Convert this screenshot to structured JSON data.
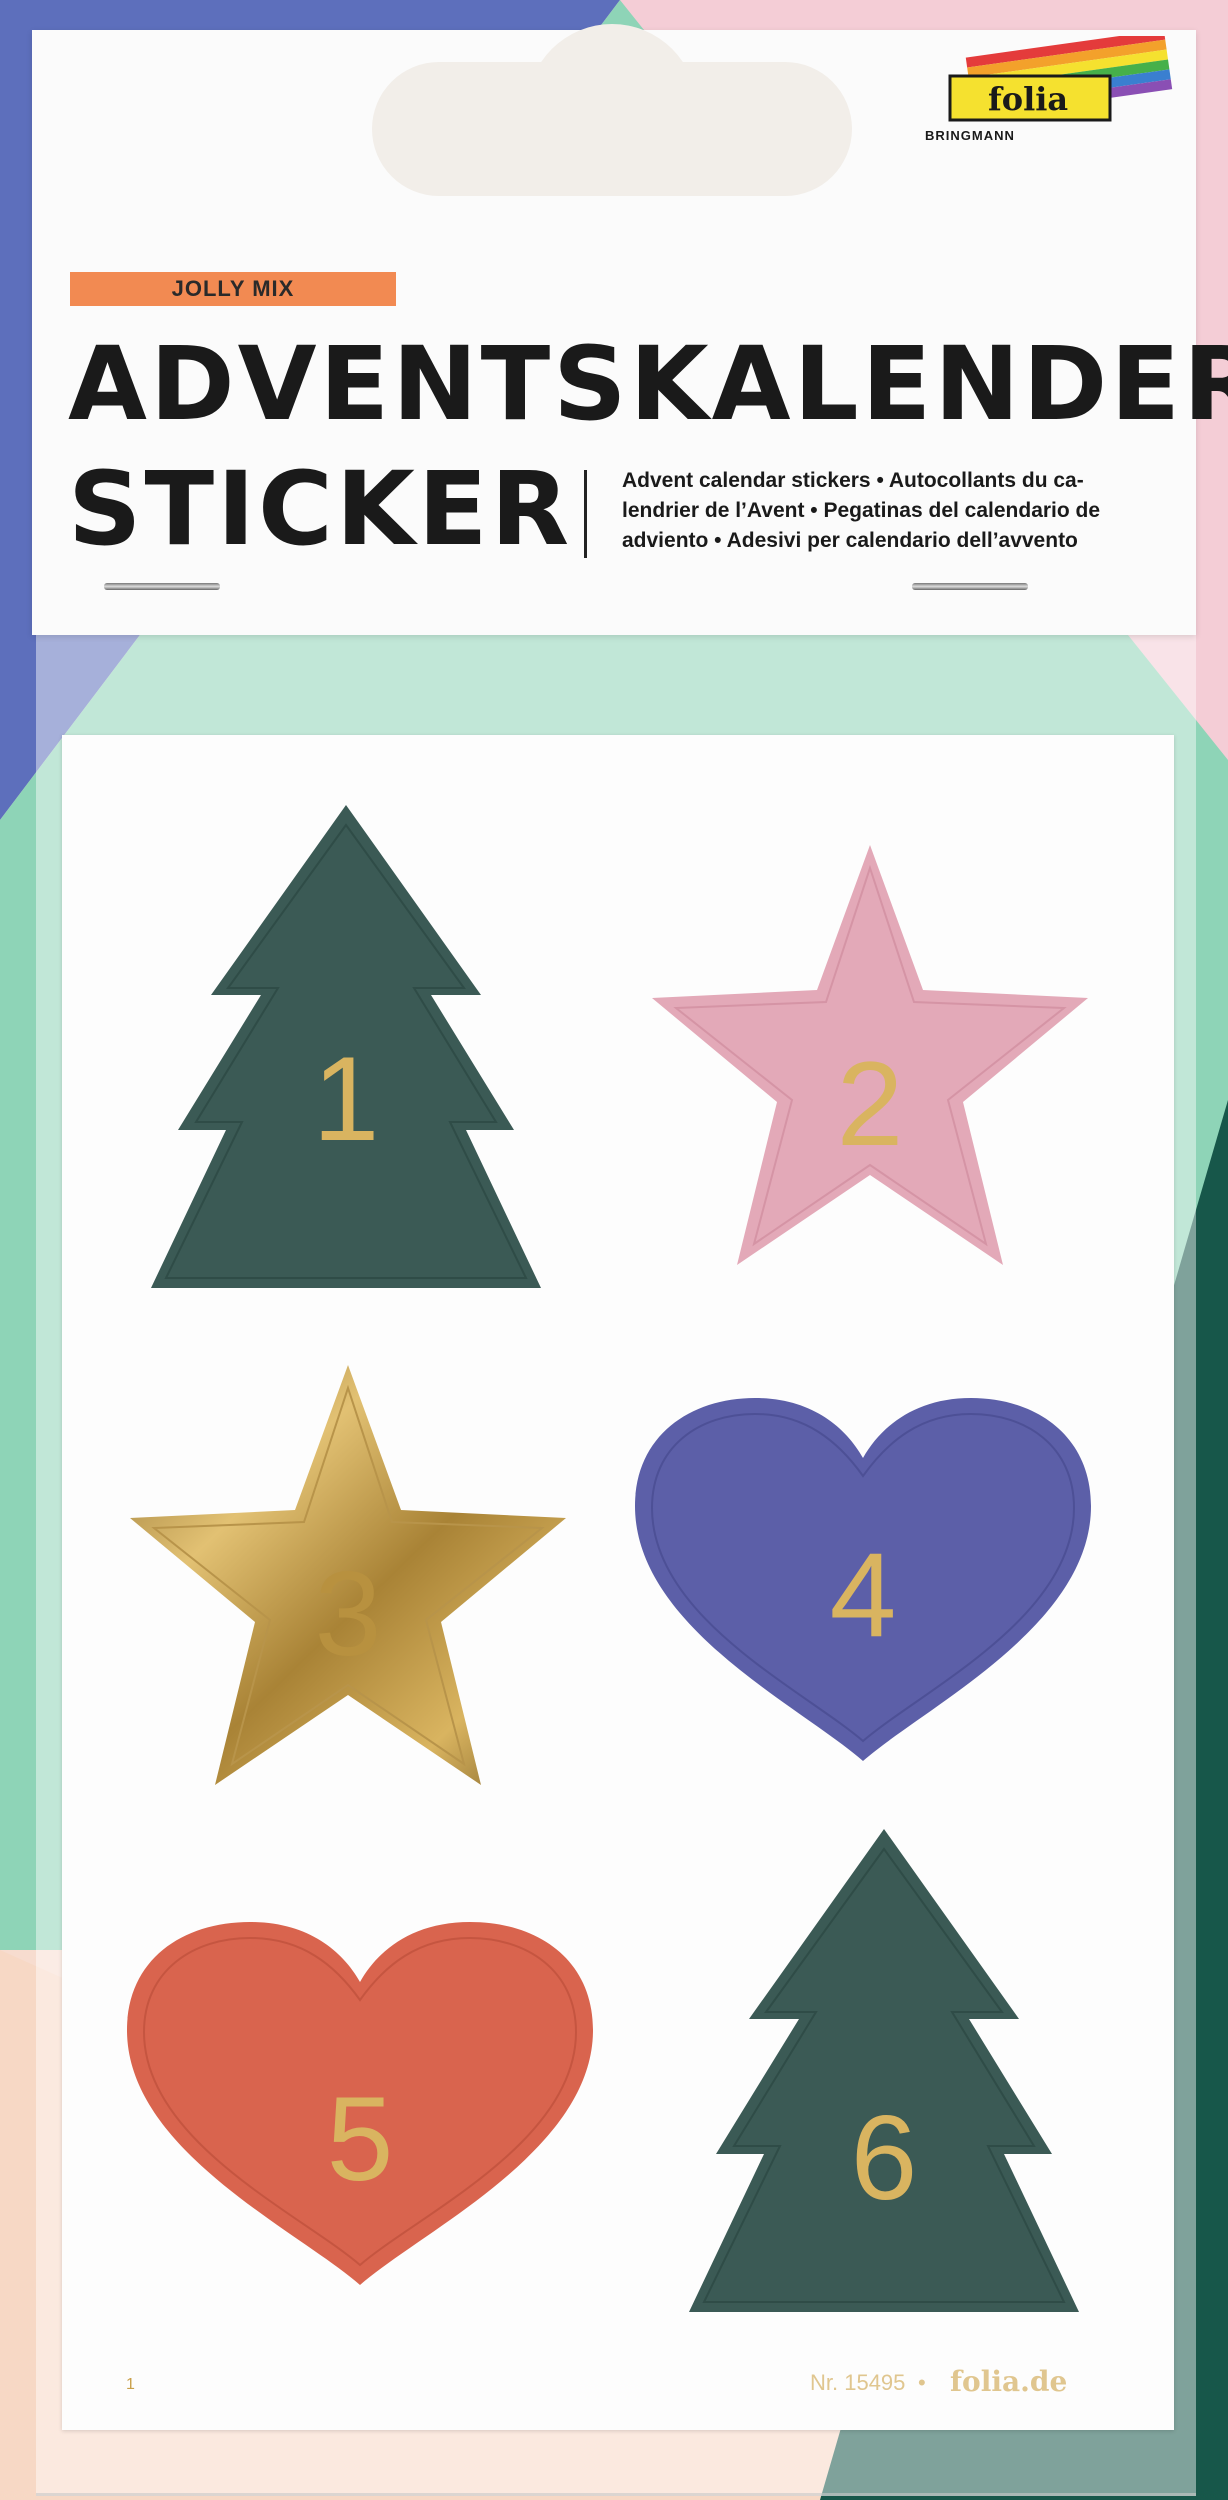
{
  "product": {
    "tag": "JOLLY MIX",
    "title_line1": "ADVENTSKALENDER",
    "title_line2": "STICKER",
    "subtitle_lines": [
      "Advent calendar stickers • Autocollants du ca-",
      "lendrier de l’Avent • Pegatinas del calendario de",
      "adviento • Adesivi per calendario dell’avvento"
    ]
  },
  "brand": {
    "name": "folia",
    "sub": "BRINGMANN"
  },
  "stickers": [
    {
      "number": "1",
      "shape": "tree-icon",
      "color": "#3b5a55"
    },
    {
      "number": "2",
      "shape": "star-icon",
      "color": "#e3a9b8"
    },
    {
      "number": "3",
      "shape": "star-icon",
      "color": "#c9a04a"
    },
    {
      "number": "4",
      "shape": "heart-icon",
      "color": "#5c5fa8"
    },
    {
      "number": "5",
      "shape": "heart-icon",
      "color": "#d9644e"
    },
    {
      "number": "6",
      "shape": "tree-icon",
      "color": "#3b5a55"
    }
  ],
  "footer": {
    "sheet_number": "1",
    "article": "Nr. 15495",
    "separator": "•",
    "brand_url": "folia.de"
  },
  "colors": {
    "gold": "#d9b460",
    "background_left": "#5d6fbc",
    "background_mint": "#8ed4b7",
    "background_teal": "#17574a",
    "background_pink": "#f4cdd6",
    "tag_orange": "#f28a52"
  }
}
